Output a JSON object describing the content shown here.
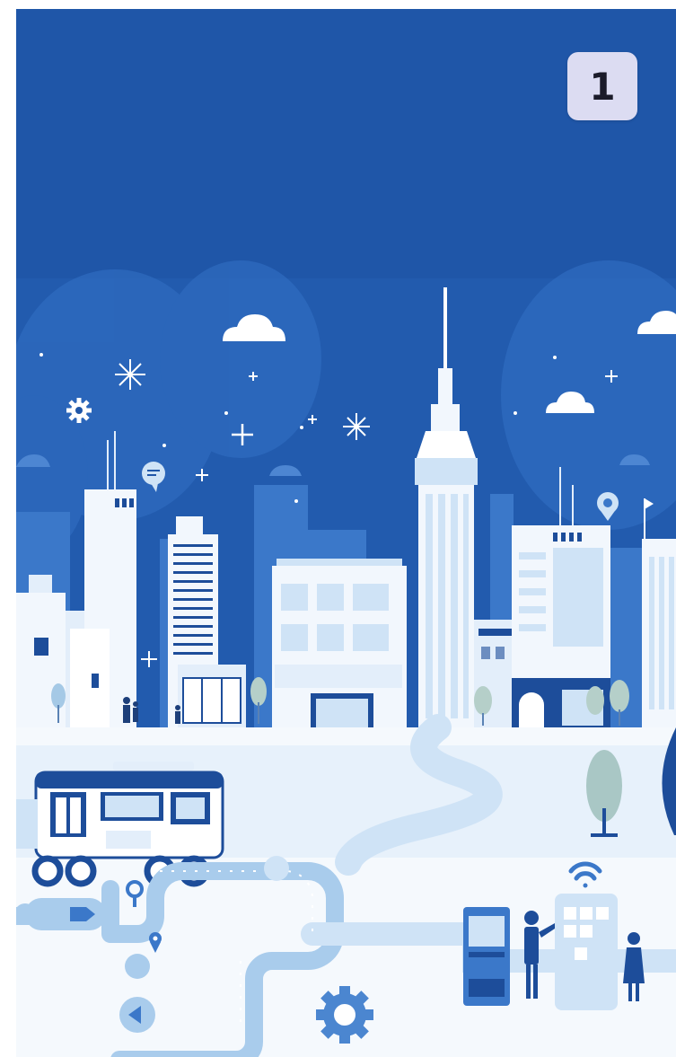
{
  "badge": {
    "number": "1"
  },
  "colors": {
    "sky": "#1e55a8",
    "sky_light": "#2a63b6",
    "building_white": "#f2f7fd",
    "building_pale": "#cfe3f6",
    "accent_blue": "#1d4d9a",
    "road": "#bcd8f2",
    "ground": "#eef5fc"
  },
  "icons": [
    "gear-icon",
    "chat-bubble-icon",
    "location-pin-icon",
    "wifi-icon",
    "bus-icon",
    "cloud-icon",
    "star-icon"
  ]
}
